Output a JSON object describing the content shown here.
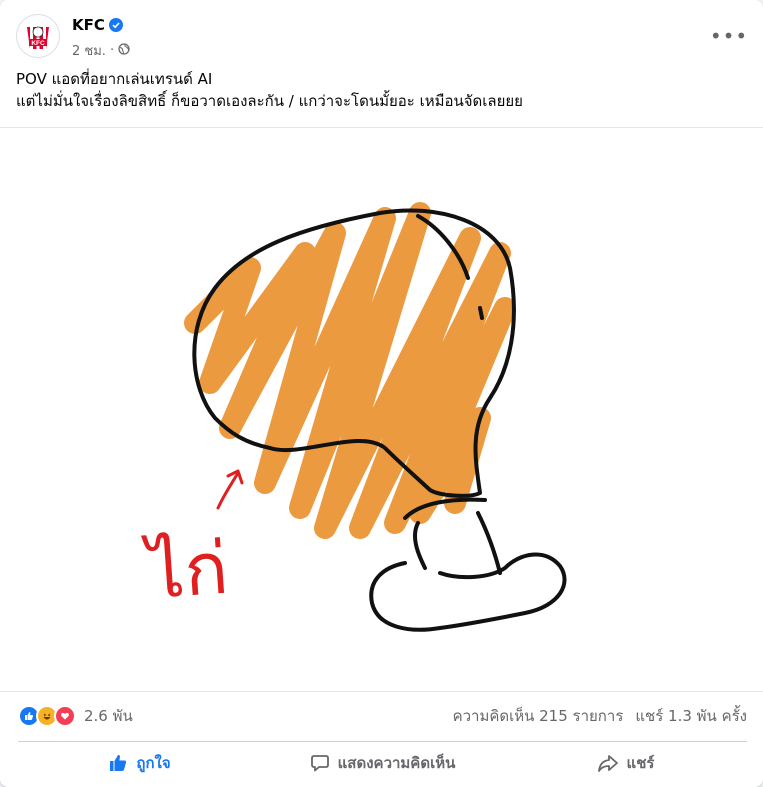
{
  "post": {
    "author": "KFC",
    "time": "2 ชม.",
    "caption_line1": "POV แอดที่อยากเล่นเทรนด์ AI",
    "caption_line2": "แต่ไม่มั่นใจเรื่องลิขสิทธิ์ ก็ขอวาดเองละกัน / แกว่าจะโดนมั้ยอะ เหมือนจัดเลยยย",
    "avatar_text": "KFC",
    "drawing_label": "ไก่"
  },
  "stats": {
    "reactions_count": "2.6 พัน",
    "comments": "ความคิดเห็น 215 รายการ",
    "shares": "แชร์ 1.3 พัน ครั้ง",
    "reaction_icons": [
      "like-icon",
      "haha-icon",
      "love-icon"
    ]
  },
  "actions": {
    "like": "ถูกใจ",
    "comment": "แสดงความคิดเห็น",
    "share": "แชร์"
  },
  "colors": {
    "accent": "#1877f2",
    "kfc_red": "#e4002b",
    "scribble_orange": "#ec9a3f",
    "ink": "#111111",
    "label_red": "#e02020"
  }
}
